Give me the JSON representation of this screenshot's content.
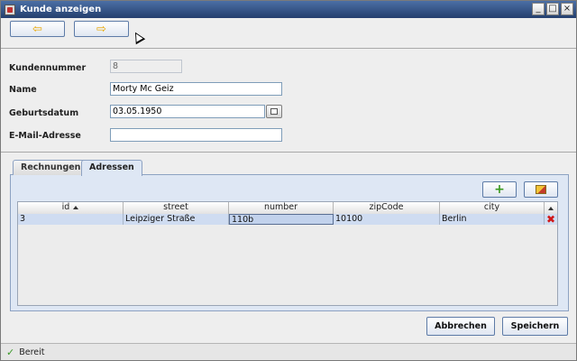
{
  "window": {
    "title": "Kunde anzeigen",
    "controls": [
      "_",
      "□",
      "×"
    ]
  },
  "nav": {
    "back_icon": "arrow-left-icon",
    "forward_icon": "arrow-right-icon"
  },
  "form": {
    "customer_number": {
      "label": "Kundennummer",
      "value": "8"
    },
    "name": {
      "label": "Name",
      "value": "Morty Mc Geiz"
    },
    "birthdate": {
      "label": "Geburtsdatum",
      "value": "03.05.1950"
    },
    "email": {
      "label": "E-Mail-Adresse",
      "value": ""
    }
  },
  "tabs": [
    {
      "label": "Rechnungen",
      "active": false
    },
    {
      "label": "Adressen",
      "active": true
    }
  ],
  "table": {
    "columns": [
      "id",
      "street",
      "number",
      "zipCode",
      "city"
    ],
    "rows": [
      [
        "3",
        "Leipziger Straße",
        "110b",
        "10100",
        "Berlin"
      ]
    ]
  },
  "buttons": {
    "cancel": "Abbrechen",
    "save": "Speichern"
  },
  "status": {
    "text": "Bereit"
  },
  "colors": {
    "accent": "#5d7ba7",
    "panel": "#dee7f4",
    "selected_row": "#cfdcf1",
    "delete": "#d01818",
    "add": "#3a9a20"
  }
}
